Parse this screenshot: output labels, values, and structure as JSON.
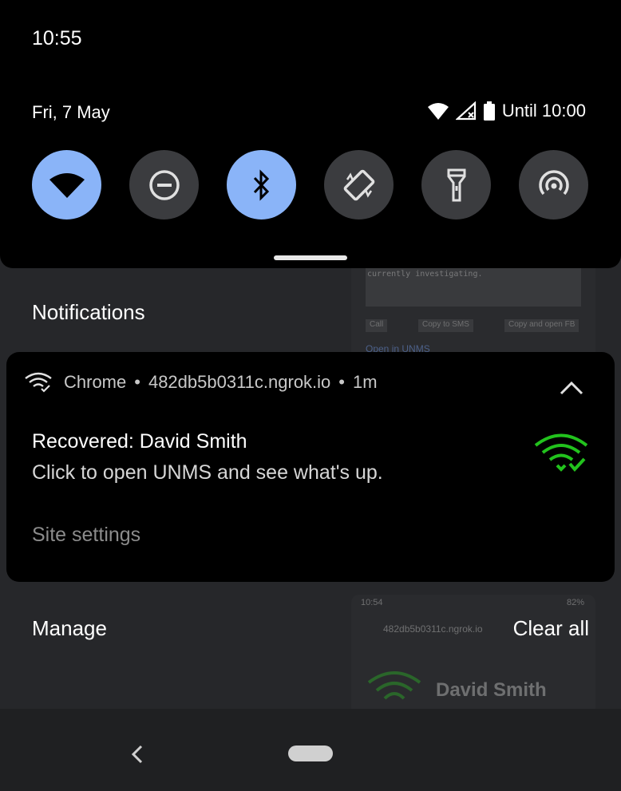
{
  "status_bar": {
    "time": "10:55",
    "date": "Fri, 7 May",
    "battery_text": "Until 10:00"
  },
  "quick_settings": {
    "tiles": [
      {
        "name": "wifi",
        "icon": "wifi-icon",
        "active": true
      },
      {
        "name": "do-not-disturb",
        "icon": "do-not-disturb-icon",
        "active": false
      },
      {
        "name": "bluetooth",
        "icon": "bluetooth-icon",
        "active": true
      },
      {
        "name": "auto-rotate",
        "icon": "auto-rotate-icon",
        "active": false
      },
      {
        "name": "flashlight",
        "icon": "flashlight-icon",
        "active": false
      },
      {
        "name": "hotspot",
        "icon": "hotspot-icon",
        "active": false
      }
    ],
    "active_color": "#8ab4f8",
    "inactive_color": "#3b3c3f"
  },
  "background_app": {
    "text_snippet": "currently investigating.",
    "buttons": [
      "Call",
      "Copy to SMS",
      "Copy and open FB"
    ],
    "link": "Open in UNMS",
    "time": "10:54",
    "battery": "82%",
    "url": "482db5b0311c.ngrok.io",
    "name": "David Smith"
  },
  "notifications": {
    "heading": "Notifications",
    "card": {
      "app": "Chrome",
      "source": "482db5b0311c.ngrok.io",
      "age": "1m",
      "title": "Recovered: David Smith",
      "body": "Click to open UNMS and see what's up.",
      "action": "Site settings",
      "icon_color": "#22c21d"
    }
  },
  "footer": {
    "manage": "Manage",
    "clear_all": "Clear all"
  }
}
